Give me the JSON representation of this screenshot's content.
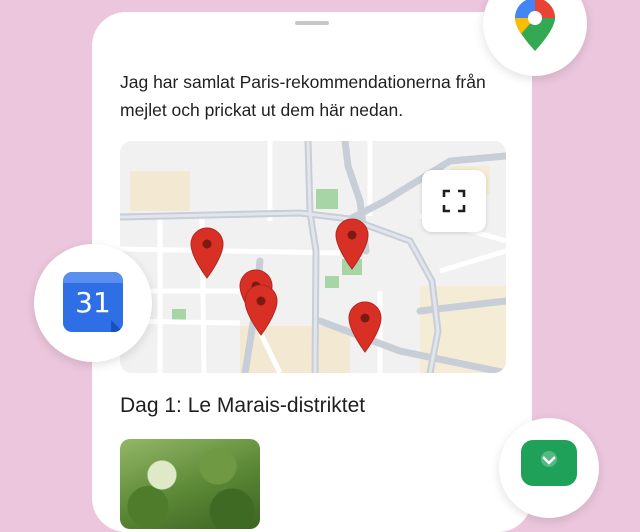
{
  "message": {
    "text": "Jag har samlat Paris-rekommendationerna från mejlet och prickat ut dem här nedan."
  },
  "map": {
    "pins": 5,
    "fullscreen_icon": "fullscreen-icon",
    "colors": {
      "pin": "#d93025",
      "road": "#c7ced8",
      "park": "#a8d5a6",
      "block": "#f3e9d2"
    }
  },
  "itinerary": {
    "day_title": "Dag 1: Le Marais-distriktet"
  },
  "apps": {
    "maps_icon": "google-maps-icon",
    "calendar_icon": "google-calendar-icon",
    "calendar_day": "31",
    "mail_icon": "inbox-icon"
  },
  "colors": {
    "background": "#ecc6dc",
    "card": "#ffffff",
    "text": "#1f1f1f"
  }
}
